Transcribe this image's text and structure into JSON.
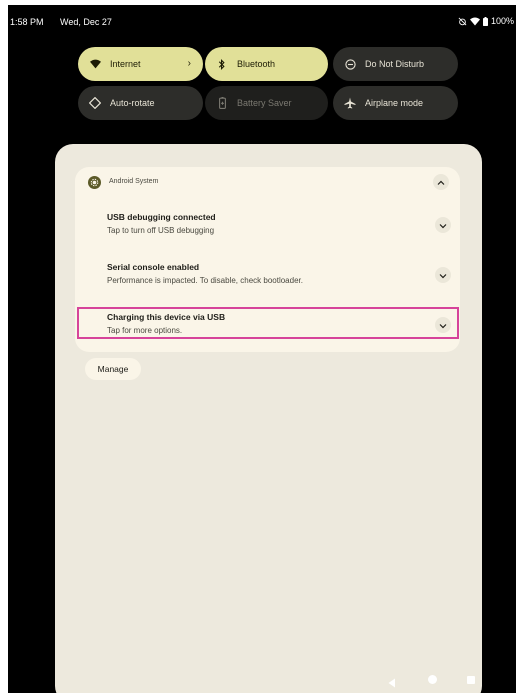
{
  "status_bar": {
    "time": "1:58 PM",
    "date": "Wed, Dec 27",
    "battery": "100%",
    "icons": [
      "alarm-off-icon",
      "wifi-icon",
      "battery-icon"
    ]
  },
  "quick_settings": [
    {
      "label": "Internet",
      "icon": "wifi-icon",
      "state": "on",
      "chevron": "›"
    },
    {
      "label": "Bluetooth",
      "icon": "bluetooth-icon",
      "state": "on"
    },
    {
      "label": "Do Not Disturb",
      "icon": "dnd-icon",
      "state": "off"
    },
    {
      "label": "Auto-rotate",
      "icon": "rotate-icon",
      "state": "off"
    },
    {
      "label": "Battery Saver",
      "icon": "battery-saver-icon",
      "state": "disabled"
    },
    {
      "label": "Airplane mode",
      "icon": "airplane-icon",
      "state": "off"
    }
  ],
  "notification_group": {
    "app_name": "Android System",
    "notifications": [
      {
        "title": "USB debugging connected",
        "text": "Tap to turn off USB debugging"
      },
      {
        "title": "Serial console enabled",
        "text": "Performance is impacted. To disable, check bootloader."
      },
      {
        "title": "Charging this device via USB",
        "text": "Tap for more options."
      }
    ]
  },
  "manage_label": "Manage",
  "colors": {
    "tile_on": "#e1e098",
    "tile_off": "#2d2d2a",
    "shade": "#ede9dd",
    "card": "#faf5e8",
    "highlight": "#d6439a"
  }
}
